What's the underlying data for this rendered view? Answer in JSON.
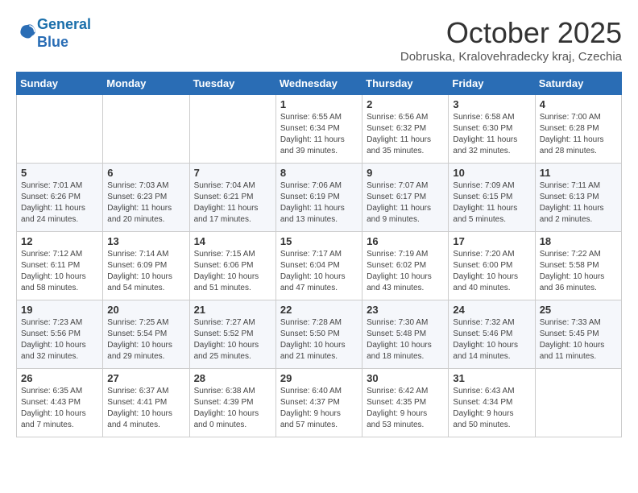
{
  "header": {
    "logo_line1": "General",
    "logo_line2": "Blue",
    "month_title": "October 2025",
    "location": "Dobruska, Kralovehradecky kraj, Czechia"
  },
  "calendar": {
    "days_of_week": [
      "Sunday",
      "Monday",
      "Tuesday",
      "Wednesday",
      "Thursday",
      "Friday",
      "Saturday"
    ],
    "weeks": [
      [
        {
          "day": "",
          "info": ""
        },
        {
          "day": "",
          "info": ""
        },
        {
          "day": "",
          "info": ""
        },
        {
          "day": "1",
          "info": "Sunrise: 6:55 AM\nSunset: 6:34 PM\nDaylight: 11 hours\nand 39 minutes."
        },
        {
          "day": "2",
          "info": "Sunrise: 6:56 AM\nSunset: 6:32 PM\nDaylight: 11 hours\nand 35 minutes."
        },
        {
          "day": "3",
          "info": "Sunrise: 6:58 AM\nSunset: 6:30 PM\nDaylight: 11 hours\nand 32 minutes."
        },
        {
          "day": "4",
          "info": "Sunrise: 7:00 AM\nSunset: 6:28 PM\nDaylight: 11 hours\nand 28 minutes."
        }
      ],
      [
        {
          "day": "5",
          "info": "Sunrise: 7:01 AM\nSunset: 6:26 PM\nDaylight: 11 hours\nand 24 minutes."
        },
        {
          "day": "6",
          "info": "Sunrise: 7:03 AM\nSunset: 6:23 PM\nDaylight: 11 hours\nand 20 minutes."
        },
        {
          "day": "7",
          "info": "Sunrise: 7:04 AM\nSunset: 6:21 PM\nDaylight: 11 hours\nand 17 minutes."
        },
        {
          "day": "8",
          "info": "Sunrise: 7:06 AM\nSunset: 6:19 PM\nDaylight: 11 hours\nand 13 minutes."
        },
        {
          "day": "9",
          "info": "Sunrise: 7:07 AM\nSunset: 6:17 PM\nDaylight: 11 hours\nand 9 minutes."
        },
        {
          "day": "10",
          "info": "Sunrise: 7:09 AM\nSunset: 6:15 PM\nDaylight: 11 hours\nand 5 minutes."
        },
        {
          "day": "11",
          "info": "Sunrise: 7:11 AM\nSunset: 6:13 PM\nDaylight: 11 hours\nand 2 minutes."
        }
      ],
      [
        {
          "day": "12",
          "info": "Sunrise: 7:12 AM\nSunset: 6:11 PM\nDaylight: 10 hours\nand 58 minutes."
        },
        {
          "day": "13",
          "info": "Sunrise: 7:14 AM\nSunset: 6:09 PM\nDaylight: 10 hours\nand 54 minutes."
        },
        {
          "day": "14",
          "info": "Sunrise: 7:15 AM\nSunset: 6:06 PM\nDaylight: 10 hours\nand 51 minutes."
        },
        {
          "day": "15",
          "info": "Sunrise: 7:17 AM\nSunset: 6:04 PM\nDaylight: 10 hours\nand 47 minutes."
        },
        {
          "day": "16",
          "info": "Sunrise: 7:19 AM\nSunset: 6:02 PM\nDaylight: 10 hours\nand 43 minutes."
        },
        {
          "day": "17",
          "info": "Sunrise: 7:20 AM\nSunset: 6:00 PM\nDaylight: 10 hours\nand 40 minutes."
        },
        {
          "day": "18",
          "info": "Sunrise: 7:22 AM\nSunset: 5:58 PM\nDaylight: 10 hours\nand 36 minutes."
        }
      ],
      [
        {
          "day": "19",
          "info": "Sunrise: 7:23 AM\nSunset: 5:56 PM\nDaylight: 10 hours\nand 32 minutes."
        },
        {
          "day": "20",
          "info": "Sunrise: 7:25 AM\nSunset: 5:54 PM\nDaylight: 10 hours\nand 29 minutes."
        },
        {
          "day": "21",
          "info": "Sunrise: 7:27 AM\nSunset: 5:52 PM\nDaylight: 10 hours\nand 25 minutes."
        },
        {
          "day": "22",
          "info": "Sunrise: 7:28 AM\nSunset: 5:50 PM\nDaylight: 10 hours\nand 21 minutes."
        },
        {
          "day": "23",
          "info": "Sunrise: 7:30 AM\nSunset: 5:48 PM\nDaylight: 10 hours\nand 18 minutes."
        },
        {
          "day": "24",
          "info": "Sunrise: 7:32 AM\nSunset: 5:46 PM\nDaylight: 10 hours\nand 14 minutes."
        },
        {
          "day": "25",
          "info": "Sunrise: 7:33 AM\nSunset: 5:45 PM\nDaylight: 10 hours\nand 11 minutes."
        }
      ],
      [
        {
          "day": "26",
          "info": "Sunrise: 6:35 AM\nSunset: 4:43 PM\nDaylight: 10 hours\nand 7 minutes."
        },
        {
          "day": "27",
          "info": "Sunrise: 6:37 AM\nSunset: 4:41 PM\nDaylight: 10 hours\nand 4 minutes."
        },
        {
          "day": "28",
          "info": "Sunrise: 6:38 AM\nSunset: 4:39 PM\nDaylight: 10 hours\nand 0 minutes."
        },
        {
          "day": "29",
          "info": "Sunrise: 6:40 AM\nSunset: 4:37 PM\nDaylight: 9 hours\nand 57 minutes."
        },
        {
          "day": "30",
          "info": "Sunrise: 6:42 AM\nSunset: 4:35 PM\nDaylight: 9 hours\nand 53 minutes."
        },
        {
          "day": "31",
          "info": "Sunrise: 6:43 AM\nSunset: 4:34 PM\nDaylight: 9 hours\nand 50 minutes."
        },
        {
          "day": "",
          "info": ""
        }
      ]
    ]
  }
}
